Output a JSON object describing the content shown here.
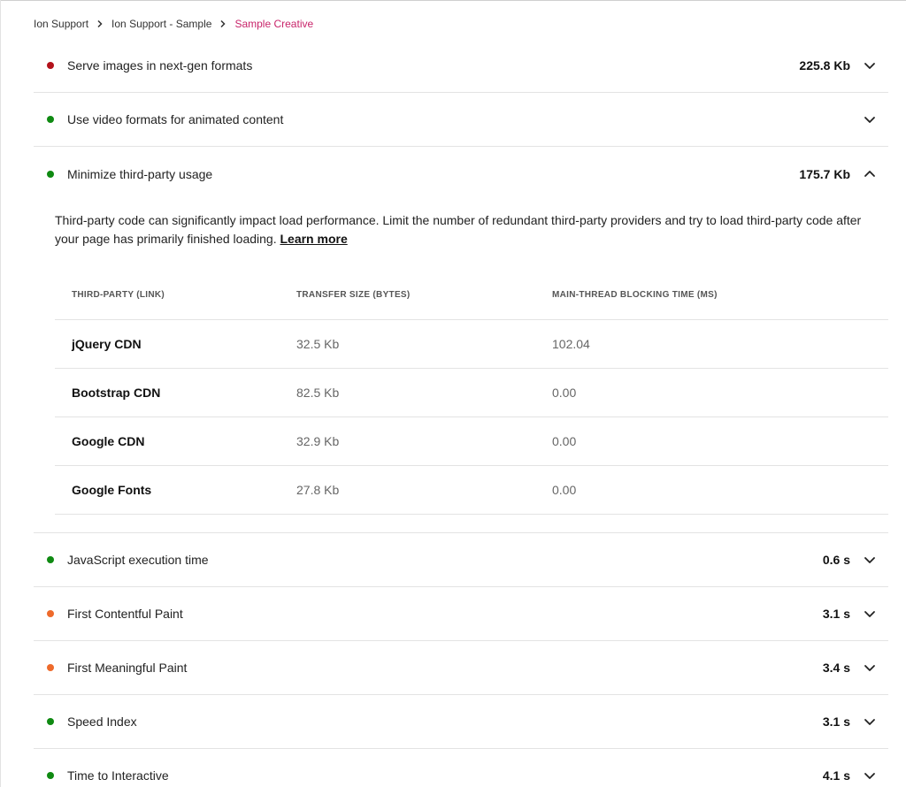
{
  "breadcrumb": {
    "items": [
      "Ion Support",
      "Ion Support - Sample"
    ],
    "current": "Sample Creative"
  },
  "colors": {
    "red": "#b3121b",
    "green": "#0f8a12",
    "orange": "#ee6a2b",
    "accent": "#c8246a"
  },
  "audits_top": [
    {
      "title": "Serve images in next-gen formats",
      "value": "225.8 Kb",
      "status": "red",
      "expanded": false
    },
    {
      "title": "Use video formats for animated content",
      "value": "",
      "status": "green",
      "expanded": false
    },
    {
      "title": "Minimize third-party usage",
      "value": "175.7 Kb",
      "status": "green",
      "expanded": true
    }
  ],
  "third_party": {
    "description": "Third-party code can significantly impact load performance. Limit the number of redundant third-party providers and try to load third-party code after your page has primarily finished loading.",
    "learn_more": "Learn more",
    "headers": [
      "THIRD-PARTY (LINK)",
      "TRANSFER SIZE (BYTES)",
      "MAIN-THREAD BLOCKING TIME (MS)"
    ],
    "rows": [
      {
        "name": "jQuery CDN",
        "size": "32.5 Kb",
        "time": "102.04"
      },
      {
        "name": "Bootstrap CDN",
        "size": "82.5 Kb",
        "time": "0.00"
      },
      {
        "name": "Google CDN",
        "size": "32.9 Kb",
        "time": "0.00"
      },
      {
        "name": "Google Fonts",
        "size": "27.8 Kb",
        "time": "0.00"
      }
    ]
  },
  "audits_bottom": [
    {
      "title": "JavaScript execution time",
      "value": "0.6 s",
      "status": "green",
      "expanded": false
    },
    {
      "title": "First Contentful Paint",
      "value": "3.1 s",
      "status": "orange",
      "expanded": false
    },
    {
      "title": "First Meaningful Paint",
      "value": "3.4 s",
      "status": "orange",
      "expanded": false
    },
    {
      "title": "Speed Index",
      "value": "3.1 s",
      "status": "green",
      "expanded": false
    },
    {
      "title": "Time to Interactive",
      "value": "4.1 s",
      "status": "green",
      "expanded": false
    }
  ]
}
